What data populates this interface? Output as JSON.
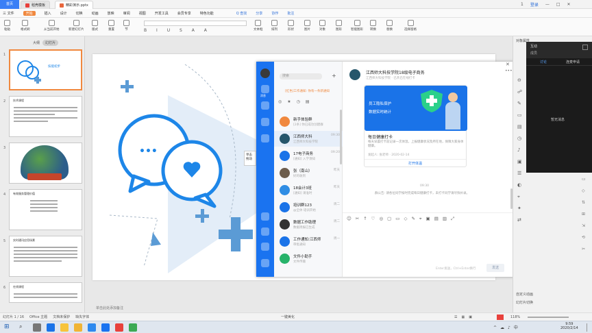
{
  "titlebar": {
    "home": "首页",
    "tabs": [
      {
        "label": "稻壳模板",
        "color": "#e8413c"
      },
      {
        "label": "精彩演示.pptx",
        "color": "#e8663c"
      }
    ],
    "right": [
      "1",
      "登录"
    ]
  },
  "menubar": {
    "items": [
      "三 文件",
      "开始",
      "插入",
      "设计",
      "切换",
      "动画",
      "放映",
      "审阅",
      "视图",
      "开发工具",
      "会员专享",
      "特色功能"
    ],
    "selected": "开始",
    "links": [
      "Q 查找",
      "分享",
      "协作",
      "批注"
    ]
  },
  "ribbon": {
    "buttons": [
      "粘贴",
      "格式刷",
      "从当前开始",
      "新建幻灯片",
      "版式",
      "重置",
      "节",
      "文本框",
      "排列",
      "形状",
      "图片",
      "对象",
      "图形",
      "智能图形",
      "转换",
      "替换",
      "选择窗格"
    ]
  },
  "leftpane": {
    "tabs": [
      "大纲",
      "幻灯片"
    ],
    "slides": [
      {
        "num": "1",
        "title": "技能初步"
      },
      {
        "num": "2",
        "title": "技术课程"
      },
      {
        "num": "3",
        "title": ""
      },
      {
        "num": "4",
        "title": "有效服务管理价值"
      },
      {
        "num": "5",
        "title": "实时通讯应用场景"
      },
      {
        "num": "6",
        "title": "在线课程"
      }
    ]
  },
  "slide_notes": "单击此处添加备注",
  "chat": {
    "profile_label": "我",
    "side_labels": [
      "消息",
      "文档",
      "日历",
      "工作台",
      "通讯录"
    ],
    "search_placeholder": "搜索",
    "banner": "[红色]工作通知: 你有一条新通知",
    "contacts": [
      {
        "name": "新手体验群",
        "sub": "[2条] 你已成功创建群",
        "time": "",
        "color": "#f0883e"
      },
      {
        "name": "江西师大科",
        "sub": "江西师大科技学院",
        "time": "09:30",
        "color": "#26566b"
      },
      {
        "name": "17电子商务",
        "sub": "[通知] 入学须知",
        "time": "09:20",
        "color": "#1a73e8"
      },
      {
        "name": "张（南山）",
        "sub": "好的收到",
        "time": "昨天",
        "color": "#6d5d4c"
      },
      {
        "name": "18会计3班",
        "sub": "[通知] 请准时",
        "time": "昨天",
        "color": "#2f8de4"
      },
      {
        "name": "培训群123",
        "sub": "@全体 培训开始",
        "time": "周二",
        "color": "#1a73e8"
      },
      {
        "name": "数据工作助理",
        "sub": "数据周报已生成",
        "time": "周二",
        "color": "#333"
      },
      {
        "name": "工作通知:江西师",
        "sub": "审批通知",
        "time": "周一",
        "color": "#1a73e8"
      },
      {
        "name": "文件小助手",
        "sub": "文件传输",
        "time": "",
        "color": "#27b36a"
      }
    ],
    "header_title": "江西师大科技学院18级电子商务",
    "header_sub": "江西师大科技学院 · 已开启在线打卡",
    "card_features": [
      "员工隐私保护",
      "数据实时统计"
    ],
    "card_title": "每日健康打卡",
    "card_body": "每天早晨打卡前记录一次体温，上报健康状况及所在地，保障大家身体健康。",
    "card_meta": "发起人: 张老师 · 2020-02-14",
    "card_link": "打开体温",
    "time_divider": "09:30",
    "system_msg": "群公告: 请各位同学按时完成每日健康打卡，未打卡同学请尽快补录。",
    "input_hint": "Enter发送，Ctrl+Enter换行",
    "send_label": "发送"
  },
  "popup": {
    "lines": [
      "单击",
      "拖动"
    ]
  },
  "rightpane": {
    "title": "对象属性",
    "items": [
      "形状选项",
      "文本选项",
      "填充",
      "线条",
      "大小",
      "属性"
    ],
    "bottom_items": [
      "自定义动画",
      "幻灯片切换"
    ]
  },
  "blackpanel": {
    "tabs": [
      "互动",
      "成员"
    ],
    "sub": [
      "讨论",
      "连麦申请"
    ],
    "center": "暂无消息"
  },
  "statusbar": {
    "left": [
      "幻灯片 1 / 16",
      "Office 主题",
      "文档未保护",
      "缺失字体"
    ],
    "center": "一键美化",
    "zoom": "118%"
  },
  "taskbar": {
    "time": "9:59",
    "date": "2020/2/14"
  },
  "colors": {
    "accent": "#f0883e",
    "brand": "#1a73f0",
    "slide_blue": "#1d86e8",
    "cross_blue": "#5b9bd5"
  }
}
